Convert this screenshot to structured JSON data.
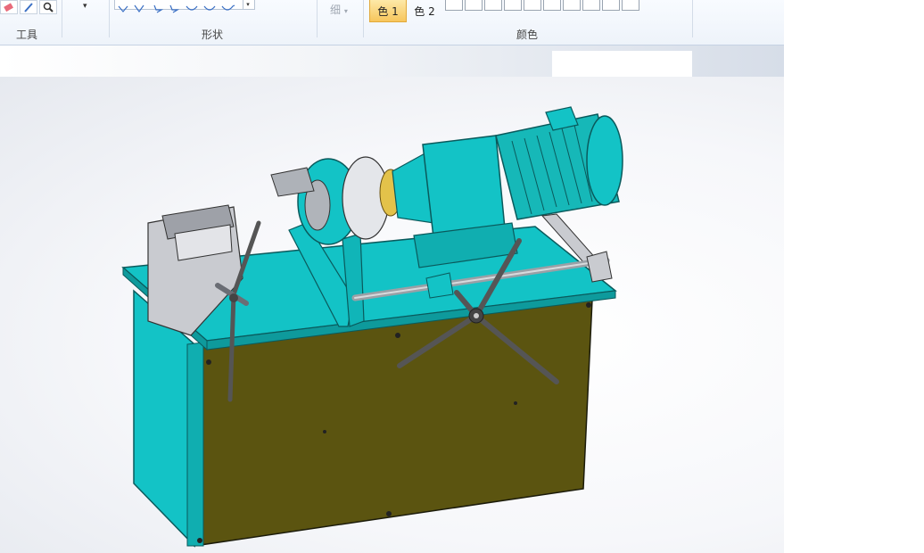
{
  "ribbon": {
    "tools_label": "工具",
    "shapes_label": "形状",
    "size_label": "细",
    "colors_label": "颜色",
    "color1_label": "色 1",
    "color2_label": "色 2",
    "dropdown_arrow": "▾"
  },
  "canvas": {
    "image_subject": "machine-assembly"
  },
  "colors": {
    "machine_teal": "#13c3c6",
    "panel_olive": "#5b5410",
    "motor_teal": "#16b8b8",
    "ribbon_bg": "#eef3fa",
    "color1_highlight": "#f7c65c"
  }
}
